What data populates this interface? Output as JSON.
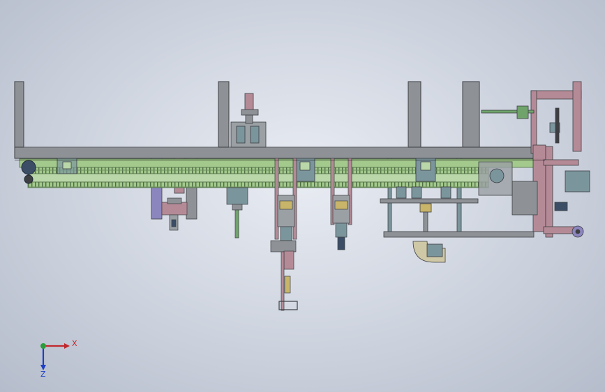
{
  "triad": {
    "x_label": "X",
    "z_label": "Z",
    "x_color": "#c0272d",
    "y_color": "#2a9d3a",
    "z_color": "#1e3fc4"
  },
  "colors": {
    "frame": "#8e9296",
    "frame_edge": "#3d3f42",
    "conveyor": "#a3c98d",
    "conveyor_dark": "#5e7f52",
    "mauve": "#b58a97",
    "purple": "#8c86bf",
    "teal": "#7b959c",
    "tan": "#c9b56a",
    "beige": "#cfc8a6"
  }
}
